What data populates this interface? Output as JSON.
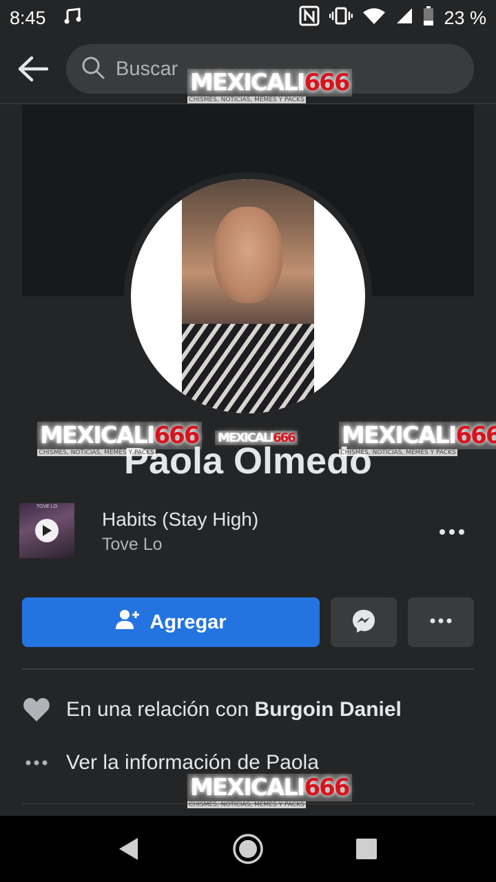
{
  "status_bar": {
    "time": "8:45",
    "music_icon": "music-note-icon",
    "battery_percent": "23 %",
    "icons": [
      "nfc-icon",
      "vibrate-icon",
      "wifi-icon",
      "signal-icon",
      "battery-icon"
    ]
  },
  "search": {
    "placeholder": "Buscar",
    "back_icon": "back-arrow-icon",
    "search_icon": "search-icon"
  },
  "profile": {
    "name": "Paola Olmedo"
  },
  "music": {
    "title": "Habits (Stay High)",
    "artist": "Tove Lo",
    "album_label": "TOVE LO"
  },
  "actions": {
    "add_label": "Agregar",
    "add_icon": "add-friend-icon",
    "messenger_icon": "messenger-icon",
    "more_icon": "more-icon"
  },
  "details": {
    "relationship_prefix": "En una relación con",
    "relationship_partner": "Burgoin Daniel",
    "see_info": "Ver la información de Paola"
  },
  "watermark": {
    "brand": "MEXICALI",
    "number": "666",
    "tagline": "CHISMES, NOTICIAS, MEMES Y PACKS"
  },
  "colors": {
    "background": "#242526",
    "accent": "#2374e1",
    "secondary_button": "#3a3b3c",
    "watermark_red": "#d7141d"
  }
}
